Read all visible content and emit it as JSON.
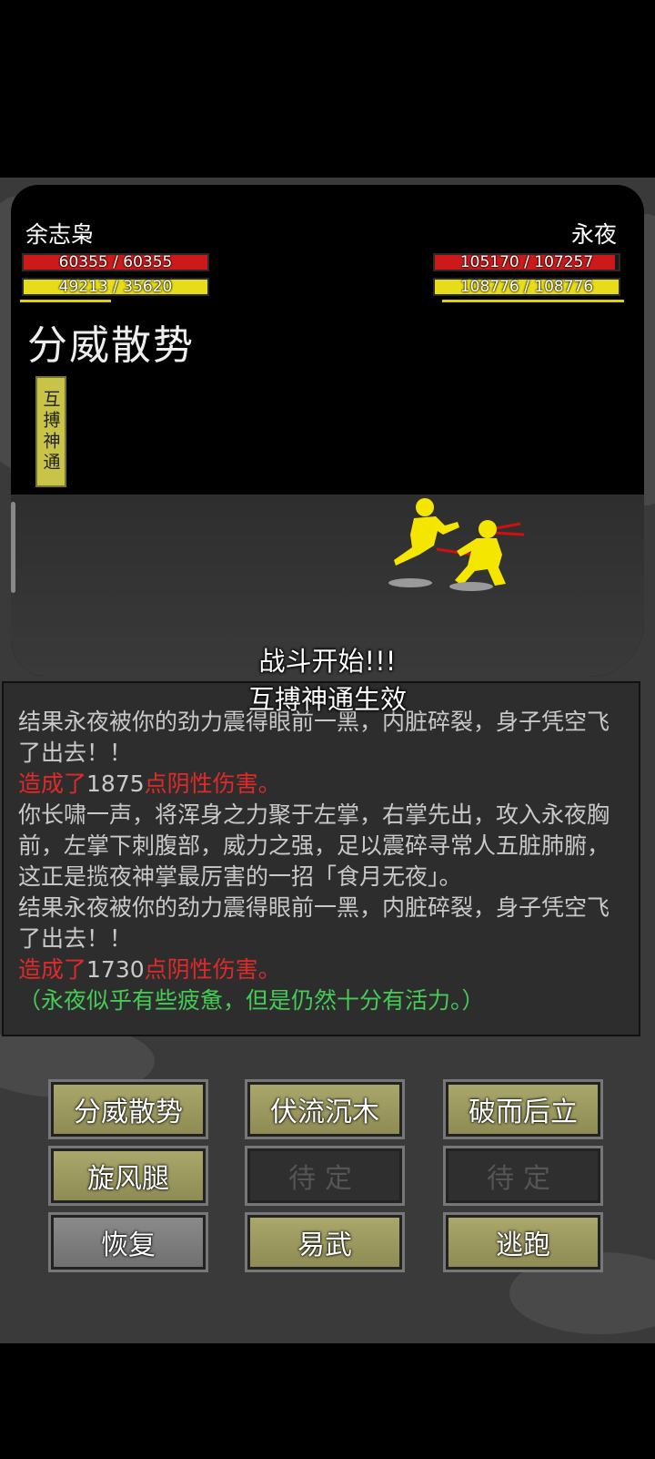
{
  "player": {
    "name": "余志枭",
    "hp_text": "60355 / 60355",
    "hp_fill": 1.0,
    "mp_text": "49213 / 35620",
    "mp_fill": 1.0
  },
  "enemy": {
    "name": "永夜",
    "hp_text": "105170 / 107257",
    "hp_fill": 0.98,
    "mp_text": "108776 / 108776",
    "mp_fill": 1.0
  },
  "current_skill": "分威散势",
  "buff_tag": "互搏神通",
  "announcements": [
    "战斗开始!!!",
    "互搏神通生效"
  ],
  "log": {
    "line1": "结果永夜被你的劲力震得眼前一黑，内脏碎裂，身子凭空飞了出去！！",
    "dmg1_prefix": "造成了",
    "dmg1_value": "1875",
    "dmg1_suffix": "点阴性伤害。",
    "line2": "你长啸一声，将浑身之力聚于左掌，右掌先出，攻入永夜胸前，左掌下刺腹部，威力之强，足以震碎寻常人五脏肺腑，这正是揽夜神掌最厉害的一招「食月无夜」。",
    "line3": "结果永夜被你的劲力震得眼前一黑，内脏碎裂，身子凭空飞了出去！！",
    "dmg2_prefix": "造成了",
    "dmg2_value": "1730",
    "dmg2_suffix": "点阴性伤害。",
    "status": "（永夜似乎有些疲惫，但是仍然十分有活力。）"
  },
  "buttons": {
    "b1": "分威散势",
    "b2": "伏流沉木",
    "b3": "破而后立",
    "b4": "旋风腿",
    "b5": "待定",
    "b6": "待定",
    "b7": "恢复",
    "b8": "易武",
    "b9": "逃跑"
  },
  "colors": {
    "hp": "#cc1a1a",
    "mp": "#e6dc1a",
    "fighter": "#f5e600",
    "accent_red": "#e02a2a",
    "status_green": "#44cc55"
  }
}
